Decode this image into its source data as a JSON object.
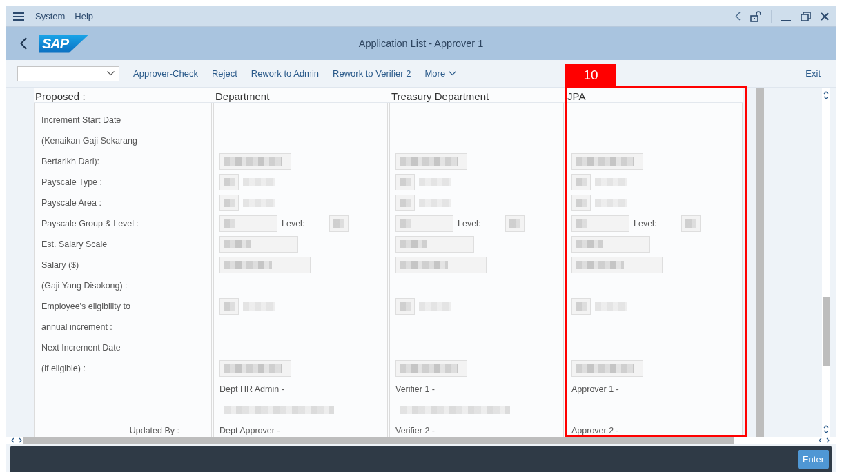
{
  "menu_bar": {
    "items": [
      "System",
      "Help"
    ]
  },
  "title_bar": {
    "logo": "SAP",
    "title": "Application List - Approver 1"
  },
  "toolbar": {
    "actions": [
      "Approver-Check",
      "Reject",
      "Rework to Admin",
      "Rework to Verifier 2"
    ],
    "more": "More",
    "exit": "Exit"
  },
  "form": {
    "header_label": "Proposed :",
    "labels": [
      "Increment Start Date",
      "(Kenaikan Gaji Sekarang",
      "Bertarikh Dari):",
      "Payscale Type :",
      "Payscale Area :",
      "Payscale Group & Level :",
      "Est. Salary Scale",
      "Salary ($)",
      "(Gaji Yang Disokong) :",
      "Employee's eligibility to",
      "annual increment :",
      "Next Increment Date",
      "(if eligible) :"
    ],
    "updated_by_label": "Updated By :",
    "columns": [
      {
        "title": "Department",
        "rows": [
          {
            "kind": "blank"
          },
          {
            "kind": "blank"
          },
          {
            "kind": "date"
          },
          {
            "kind": "code"
          },
          {
            "kind": "code"
          },
          {
            "kind": "level",
            "label": "Level:"
          },
          {
            "kind": "scale"
          },
          {
            "kind": "amount"
          },
          {
            "kind": "blank"
          },
          {
            "kind": "code"
          },
          {
            "kind": "blank"
          },
          {
            "kind": "blank"
          },
          {
            "kind": "date"
          },
          {
            "kind": "text",
            "text": "Dept HR Admin -"
          },
          {
            "kind": "hidden_name"
          },
          {
            "kind": "text",
            "text": "Dept Approver -"
          }
        ]
      },
      {
        "title": "Treasury Department",
        "rows": [
          {
            "kind": "blank"
          },
          {
            "kind": "blank"
          },
          {
            "kind": "date"
          },
          {
            "kind": "code"
          },
          {
            "kind": "code"
          },
          {
            "kind": "level",
            "label": "Level:"
          },
          {
            "kind": "scale"
          },
          {
            "kind": "amount"
          },
          {
            "kind": "blank"
          },
          {
            "kind": "code"
          },
          {
            "kind": "blank"
          },
          {
            "kind": "blank"
          },
          {
            "kind": "date"
          },
          {
            "kind": "text",
            "text": "Verifier 1 -"
          },
          {
            "kind": "hidden_name"
          },
          {
            "kind": "text",
            "text": "Verifier 2 -"
          }
        ]
      },
      {
        "title": "JPA",
        "rows": [
          {
            "kind": "blank"
          },
          {
            "kind": "blank"
          },
          {
            "kind": "date"
          },
          {
            "kind": "code"
          },
          {
            "kind": "code"
          },
          {
            "kind": "level",
            "label": "Level:"
          },
          {
            "kind": "scale"
          },
          {
            "kind": "amount"
          },
          {
            "kind": "blank"
          },
          {
            "kind": "code"
          },
          {
            "kind": "blank"
          },
          {
            "kind": "blank"
          },
          {
            "kind": "date"
          },
          {
            "kind": "text",
            "text": "Approver 1 -"
          },
          {
            "kind": "blank"
          },
          {
            "kind": "text",
            "text": "Approver 2 -"
          }
        ]
      }
    ]
  },
  "annotation": {
    "label": "10"
  },
  "footer": {
    "button": "Enter"
  }
}
